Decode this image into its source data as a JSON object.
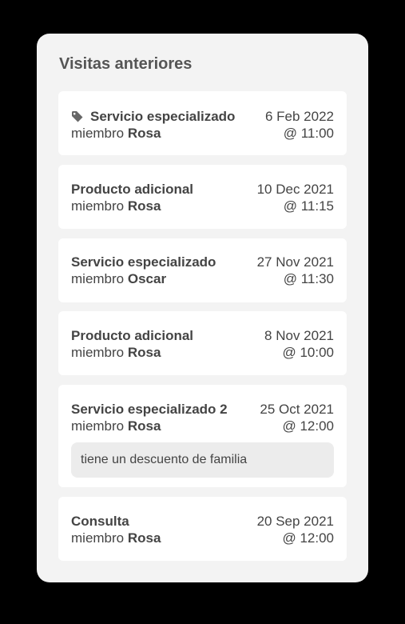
{
  "panel": {
    "title": "Visitas anteriores"
  },
  "member_prefix": "miembro",
  "visits": [
    {
      "service": "Servicio especializado",
      "member": "Rosa",
      "date": "6 Feb 2022",
      "time": "@ 11:00",
      "icon": "tag-icon"
    },
    {
      "service": "Producto adicional",
      "member": "Rosa",
      "date": "10 Dec 2021",
      "time": "@ 11:15"
    },
    {
      "service": "Servicio especializado",
      "member": "Oscar",
      "date": "27 Nov 2021",
      "time": "@ 11:30"
    },
    {
      "service": "Producto adicional",
      "member": "Rosa",
      "date": "8 Nov 2021",
      "time": "@ 10:00"
    },
    {
      "service": "Servicio especializado 2",
      "member": "Rosa",
      "date": "25 Oct 2021",
      "time": "@ 12:00",
      "note": "tiene un descuento de familia"
    },
    {
      "service": "Consulta",
      "member": "Rosa",
      "date": "20 Sep 2021",
      "time": "@ 12:00"
    }
  ],
  "colors": {
    "background": "#000000",
    "panel": "#f3f3f3",
    "card": "#ffffff",
    "note": "#ececec",
    "text": "#444444"
  }
}
